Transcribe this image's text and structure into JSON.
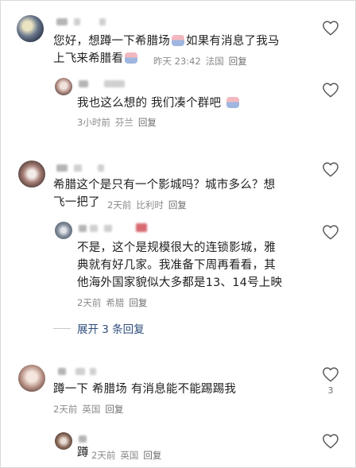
{
  "comments": [
    {
      "text_line1": "您好，想蹲一下希腊场",
      "text_line1b": "如果有消息了我马",
      "text_line2": "上飞来希腊看",
      "time": "昨天 23:42",
      "location": "法国",
      "reply_label": "回复",
      "replies": [
        {
          "text": "我也这么想的 我们凑个群吧",
          "time": "3小时前",
          "location": "芬兰",
          "reply_label": "回复"
        }
      ]
    },
    {
      "text_line1": "希腊这个是只有一个影城吗？城市多么？想",
      "text_line2": "飞一把了",
      "time": "2天前",
      "location": "比利时",
      "reply_label": "回复",
      "replies": [
        {
          "text_line1": "不是，这个是规模很大的连锁影城，雅",
          "text_line2": "典就有好几家。我准备下周再看看，其",
          "text_line3": "他海外国家貌似大多都是13、14号上映",
          "time": "2天前",
          "location": "希腊",
          "reply_label": "回复"
        }
      ],
      "expand_label": "展开 3 条回复"
    },
    {
      "text": "蹲一下 希腊场 有消息能不能踢踢我",
      "time": "2天前",
      "location": "英国",
      "reply_label": "回复",
      "like_count": "3",
      "replies": [
        {
          "text": "蹲",
          "time": "2天前",
          "location": "英国",
          "reply_label": "回复"
        }
      ]
    }
  ],
  "icons": {
    "like": "heart-outline-icon",
    "emoji": "sticker-emoji-icon"
  },
  "colors": {
    "link": "#2e4d7a",
    "meta": "#8a8a8a",
    "text": "#1f1f1f"
  }
}
